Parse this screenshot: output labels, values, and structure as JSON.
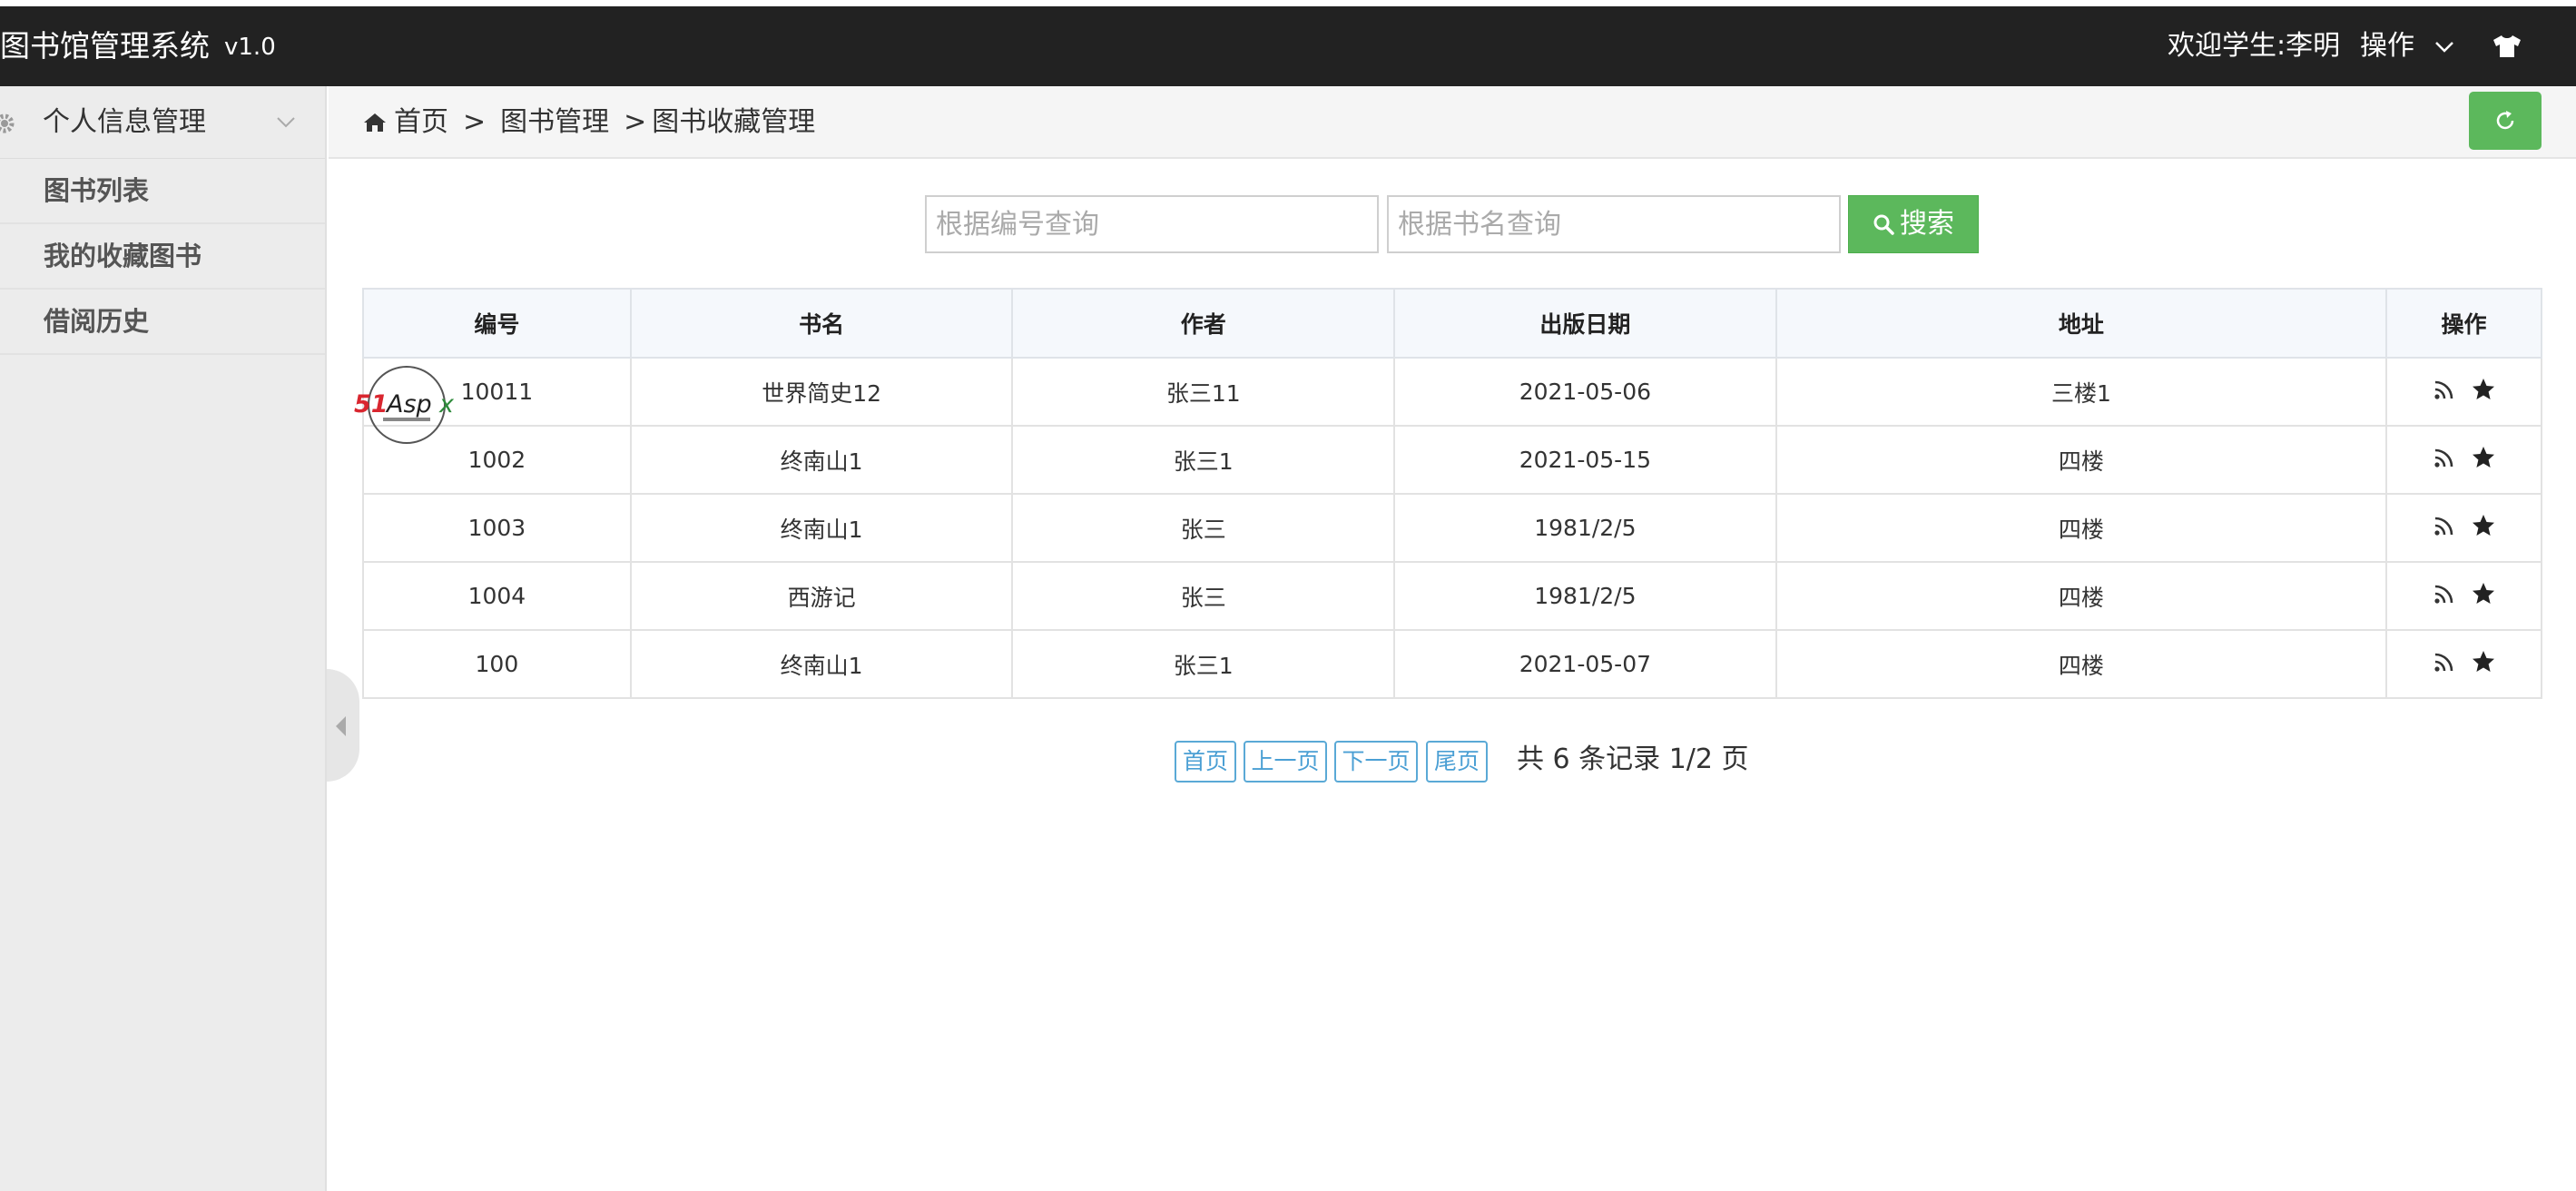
{
  "header": {
    "title": "图书馆管理系统",
    "version": "v1.0",
    "welcome": "欢迎学生:李明",
    "ops_label": "操作",
    "ops_icon": "chevron-down-icon",
    "theme_icon": "tshirt-icon"
  },
  "sidebar": {
    "group_label": "个人信息管理",
    "group_icon": "gear-icon",
    "items": [
      {
        "label": "图书列表"
      },
      {
        "label": "我的收藏图书"
      },
      {
        "label": "借阅历史"
      }
    ]
  },
  "breadcrumb": {
    "home": "首页",
    "level1": "图书管理",
    "level2": "图书收藏管理",
    "sep": ">"
  },
  "search": {
    "code_placeholder": "根据编号查询",
    "name_placeholder": "根据书名查询",
    "button_label": "搜索"
  },
  "table": {
    "headers": [
      "编号",
      "书名",
      "作者",
      "出版日期",
      "地址",
      "操作"
    ],
    "rows": [
      [
        "10011",
        "世界简史12",
        "张三11",
        "2021-05-06",
        "三楼1"
      ],
      [
        "1002",
        "终南山1",
        "张三1",
        "2021-05-15",
        "四楼"
      ],
      [
        "1003",
        "终南山1",
        "张三",
        "1981/2/5",
        "四楼"
      ],
      [
        "1004",
        "西游记",
        "张三",
        "1981/2/5",
        "四楼"
      ],
      [
        "100",
        "终南山1",
        "张三1",
        "2021-05-07",
        "四楼"
      ]
    ],
    "row_action_icons": [
      "rss-icon",
      "star-icon"
    ]
  },
  "watermark": {
    "text": "51Aspx"
  },
  "pagination": {
    "first": "首页",
    "prev": "上一页",
    "next": "下一页",
    "last": "尾页",
    "info": "共 6 条记录 1/2 页"
  },
  "colors": {
    "topbar": "#222222",
    "accent_green": "#5cb85c",
    "pager_blue": "#4a9fd4",
    "sidebar_bg": "#ececec"
  }
}
